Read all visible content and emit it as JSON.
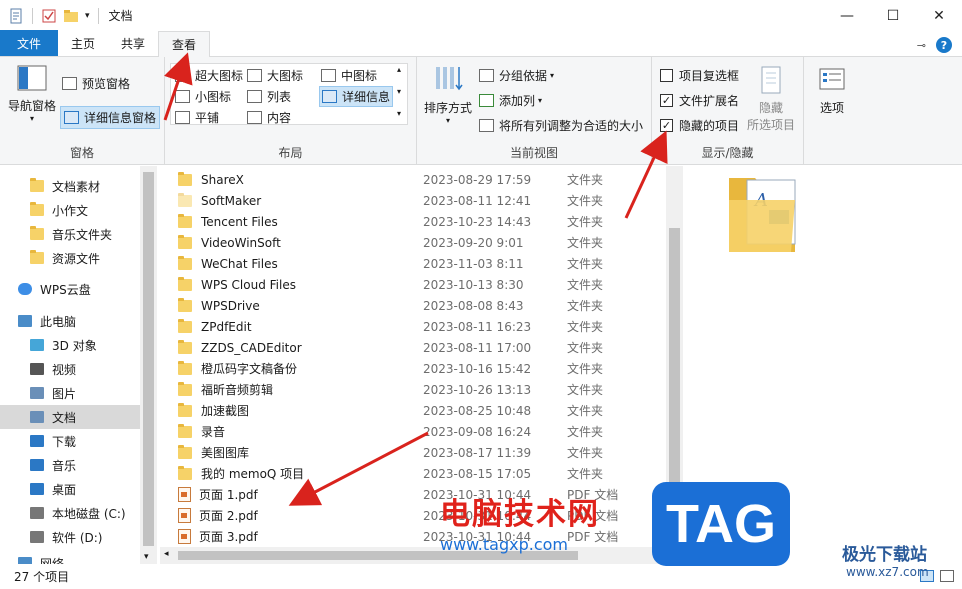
{
  "window": {
    "title": "文档",
    "minimize": "—",
    "maximize": "☐",
    "close": "✕"
  },
  "tabs": {
    "file": "文件",
    "home": "主页",
    "share": "共享",
    "view": "查看"
  },
  "ribbon": {
    "panes": {
      "nav_pane": "导航窗格",
      "preview_pane": "预览窗格",
      "details_pane": "详细信息窗格",
      "label": "窗格"
    },
    "layout": {
      "extra_large": "超大图标",
      "large": "大图标",
      "medium": "中图标",
      "small": "小图标",
      "list": "列表",
      "details": "详细信息",
      "tiles": "平铺",
      "content": "内容",
      "label": "布局"
    },
    "current_view": {
      "sort_by": "排序方式",
      "group_by": "分组依据",
      "add_columns": "添加列",
      "size_all_columns": "将所有列调整为合适的大小",
      "label": "当前视图"
    },
    "show_hide": {
      "item_checkboxes": "项目复选框",
      "file_extensions": "文件扩展名",
      "hidden_items": "隐藏的项目",
      "item_checkboxes_checked": false,
      "file_extensions_checked": true,
      "hidden_items_checked": true,
      "hide_selected": "隐藏",
      "hide_selected_sub": "所选项目",
      "label": "显示/隐藏"
    },
    "options": "选项"
  },
  "nav": {
    "items": [
      {
        "label": "文档素材",
        "icon": "folder-icon"
      },
      {
        "label": "小作文",
        "icon": "folder-icon"
      },
      {
        "label": "音乐文件夹",
        "icon": "folder-icon"
      },
      {
        "label": "资源文件",
        "icon": "folder-icon"
      },
      {
        "label": "WPS云盘",
        "icon": "cloud-icon"
      },
      {
        "label": "此电脑",
        "icon": "computer-icon"
      },
      {
        "label": "3D 对象",
        "icon": "cube-icon"
      },
      {
        "label": "视频",
        "icon": "video-icon"
      },
      {
        "label": "图片",
        "icon": "picture-icon"
      },
      {
        "label": "文档",
        "icon": "document-icon"
      },
      {
        "label": "下载",
        "icon": "download-icon"
      },
      {
        "label": "音乐",
        "icon": "music-icon"
      },
      {
        "label": "桌面",
        "icon": "desktop-icon"
      },
      {
        "label": "本地磁盘 (C:)",
        "icon": "drive-icon"
      },
      {
        "label": "软件 (D:)",
        "icon": "drive-icon"
      },
      {
        "label": "网络",
        "icon": "network-icon"
      }
    ]
  },
  "files": [
    {
      "name": "ShareX",
      "date": "2023-08-29 17:59",
      "type": "文件夹",
      "kind": "folder"
    },
    {
      "name": "SoftMaker",
      "date": "2023-08-11 12:41",
      "type": "文件夹",
      "kind": "folder"
    },
    {
      "name": "Tencent Files",
      "date": "2023-10-23 14:43",
      "type": "文件夹",
      "kind": "folder"
    },
    {
      "name": "VideoWinSoft",
      "date": "2023-09-20 9:01",
      "type": "文件夹",
      "kind": "folder"
    },
    {
      "name": "WeChat Files",
      "date": "2023-11-03 8:11",
      "type": "文件夹",
      "kind": "folder"
    },
    {
      "name": "WPS Cloud Files",
      "date": "2023-10-13 8:30",
      "type": "文件夹",
      "kind": "folder"
    },
    {
      "name": "WPSDrive",
      "date": "2023-08-08 8:43",
      "type": "文件夹",
      "kind": "folder"
    },
    {
      "name": "ZPdfEdit",
      "date": "2023-08-11 16:23",
      "type": "文件夹",
      "kind": "folder"
    },
    {
      "name": "ZZDS_CADEditor",
      "date": "2023-08-11 17:00",
      "type": "文件夹",
      "kind": "folder"
    },
    {
      "name": "橙瓜码字文稿备份",
      "date": "2023-10-16 15:42",
      "type": "文件夹",
      "kind": "folder"
    },
    {
      "name": "福昕音频剪辑",
      "date": "2023-10-26 13:13",
      "type": "文件夹",
      "kind": "folder"
    },
    {
      "name": "加速截图",
      "date": "2023-08-25 10:48",
      "type": "文件夹",
      "kind": "folder"
    },
    {
      "name": "录音",
      "date": "2023-09-08 16:24",
      "type": "文件夹",
      "kind": "folder"
    },
    {
      "name": "美图图库",
      "date": "2023-08-17 11:39",
      "type": "文件夹",
      "kind": "folder"
    },
    {
      "name": "我的 memoQ 项目",
      "date": "2023-08-15 17:05",
      "type": "文件夹",
      "kind": "folder"
    },
    {
      "name": "页面 1.pdf",
      "date": "2023-10-31 10:44",
      "type": "PDF 文档",
      "kind": "pdf"
    },
    {
      "name": "页面 2.pdf",
      "date": "2023-10-31 10:44",
      "type": "PDF 文档",
      "kind": "pdf"
    },
    {
      "name": "页面 3.pdf",
      "date": "2023-10-31 10:44",
      "type": "PDF 文档",
      "kind": "pdf"
    }
  ],
  "status": {
    "count": "27 个项目"
  },
  "watermarks": {
    "site_name": "电脑技术网",
    "site_url": "www.tagxp.com",
    "tag": "TAG",
    "jg_name": "极光下载站",
    "jg_url": "www.xz7.com"
  },
  "colors": {
    "accent": "#1979ca",
    "arrow": "#d9231d",
    "watermark_red": "#e0221b",
    "tag_blue": "#1b6fd6"
  }
}
